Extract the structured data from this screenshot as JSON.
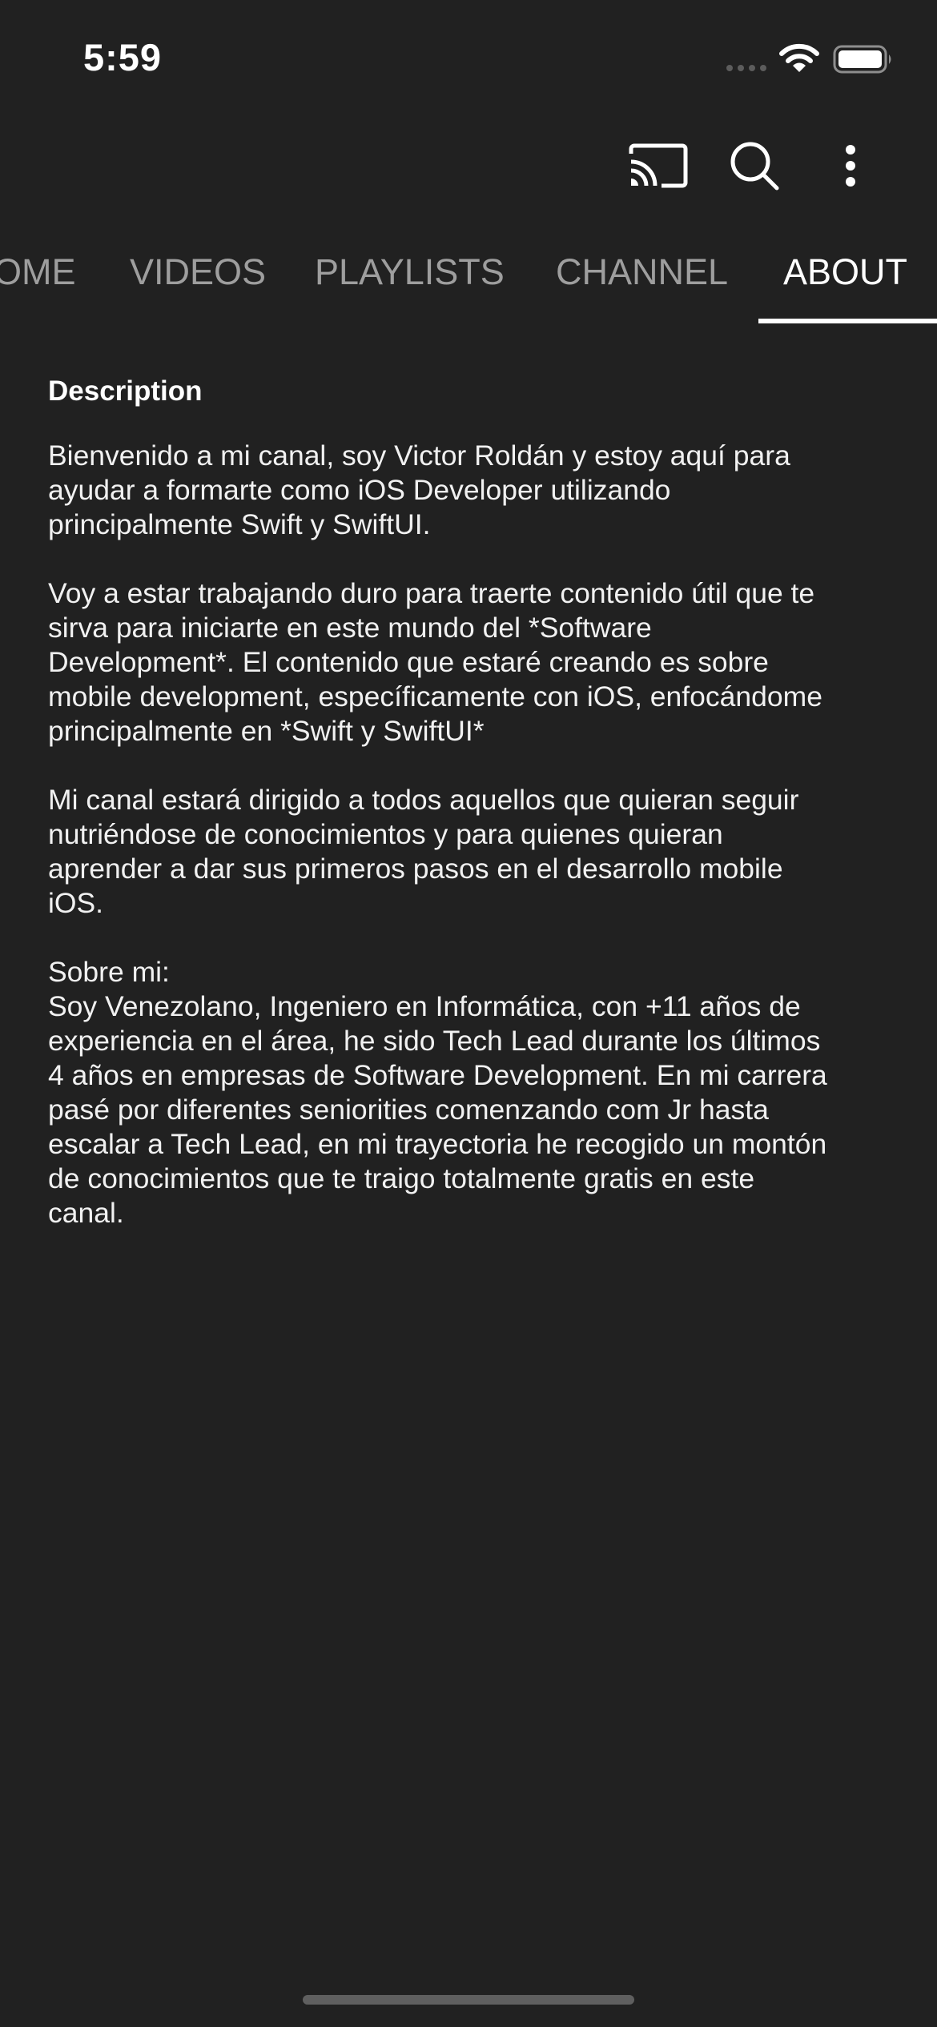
{
  "status_bar": {
    "time": "5:59",
    "signal_icon": "signal-dots-icon",
    "wifi_icon": "wifi-icon",
    "battery_icon": "battery-full-icon"
  },
  "toolbar": {
    "cast_icon": "cast-icon",
    "search_icon": "search-icon",
    "more_icon": "more-vertical-icon"
  },
  "tabs": [
    {
      "label": "OME",
      "active": false
    },
    {
      "label": "VIDEOS",
      "active": false
    },
    {
      "label": "PLAYLISTS",
      "active": false
    },
    {
      "label": "CHANNEL",
      "active": false
    },
    {
      "label": "ABOUT",
      "active": true
    }
  ],
  "about": {
    "title": "Description",
    "text": "Bienvenido a mi canal, soy Victor Roldán y estoy aquí para\nayudar a formarte como iOS Developer utilizando\nprincipalmente Swift y SwiftUI.\n\nVoy a estar trabajando duro para traerte contenido útil que te\nsirva para iniciarte en este mundo del *Software\nDevelopment*. El contenido que estaré creando es sobre\nmobile development, específicamente con iOS, enfocándome\nprincipalmente en *Swift y SwiftUI*\n\nMi canal estará dirigido a todos aquellos que quieran seguir\nnutriéndose de conocimientos y para quienes quieran\naprender a dar sus primeros pasos en el desarrollo mobile\niOS.\n\nSobre mi:\nSoy Venezolano, Ingeniero en Informática, con +11 años de\nexperiencia en el área, he sido Tech Lead durante los últimos\n4 años en empresas de Software Development. En mi carrera\npasé por diferentes seniorities comenzando com Jr hasta\nescalar a Tech Lead, en mi trayectoria he recogido un montón\nde conocimientos que te traigo totalmente gratis en este\ncanal."
  },
  "colors": {
    "background": "#212121",
    "tab_inactive": "#9e9e9e",
    "tab_active": "#ffffff",
    "text": "#f1f1f1"
  }
}
